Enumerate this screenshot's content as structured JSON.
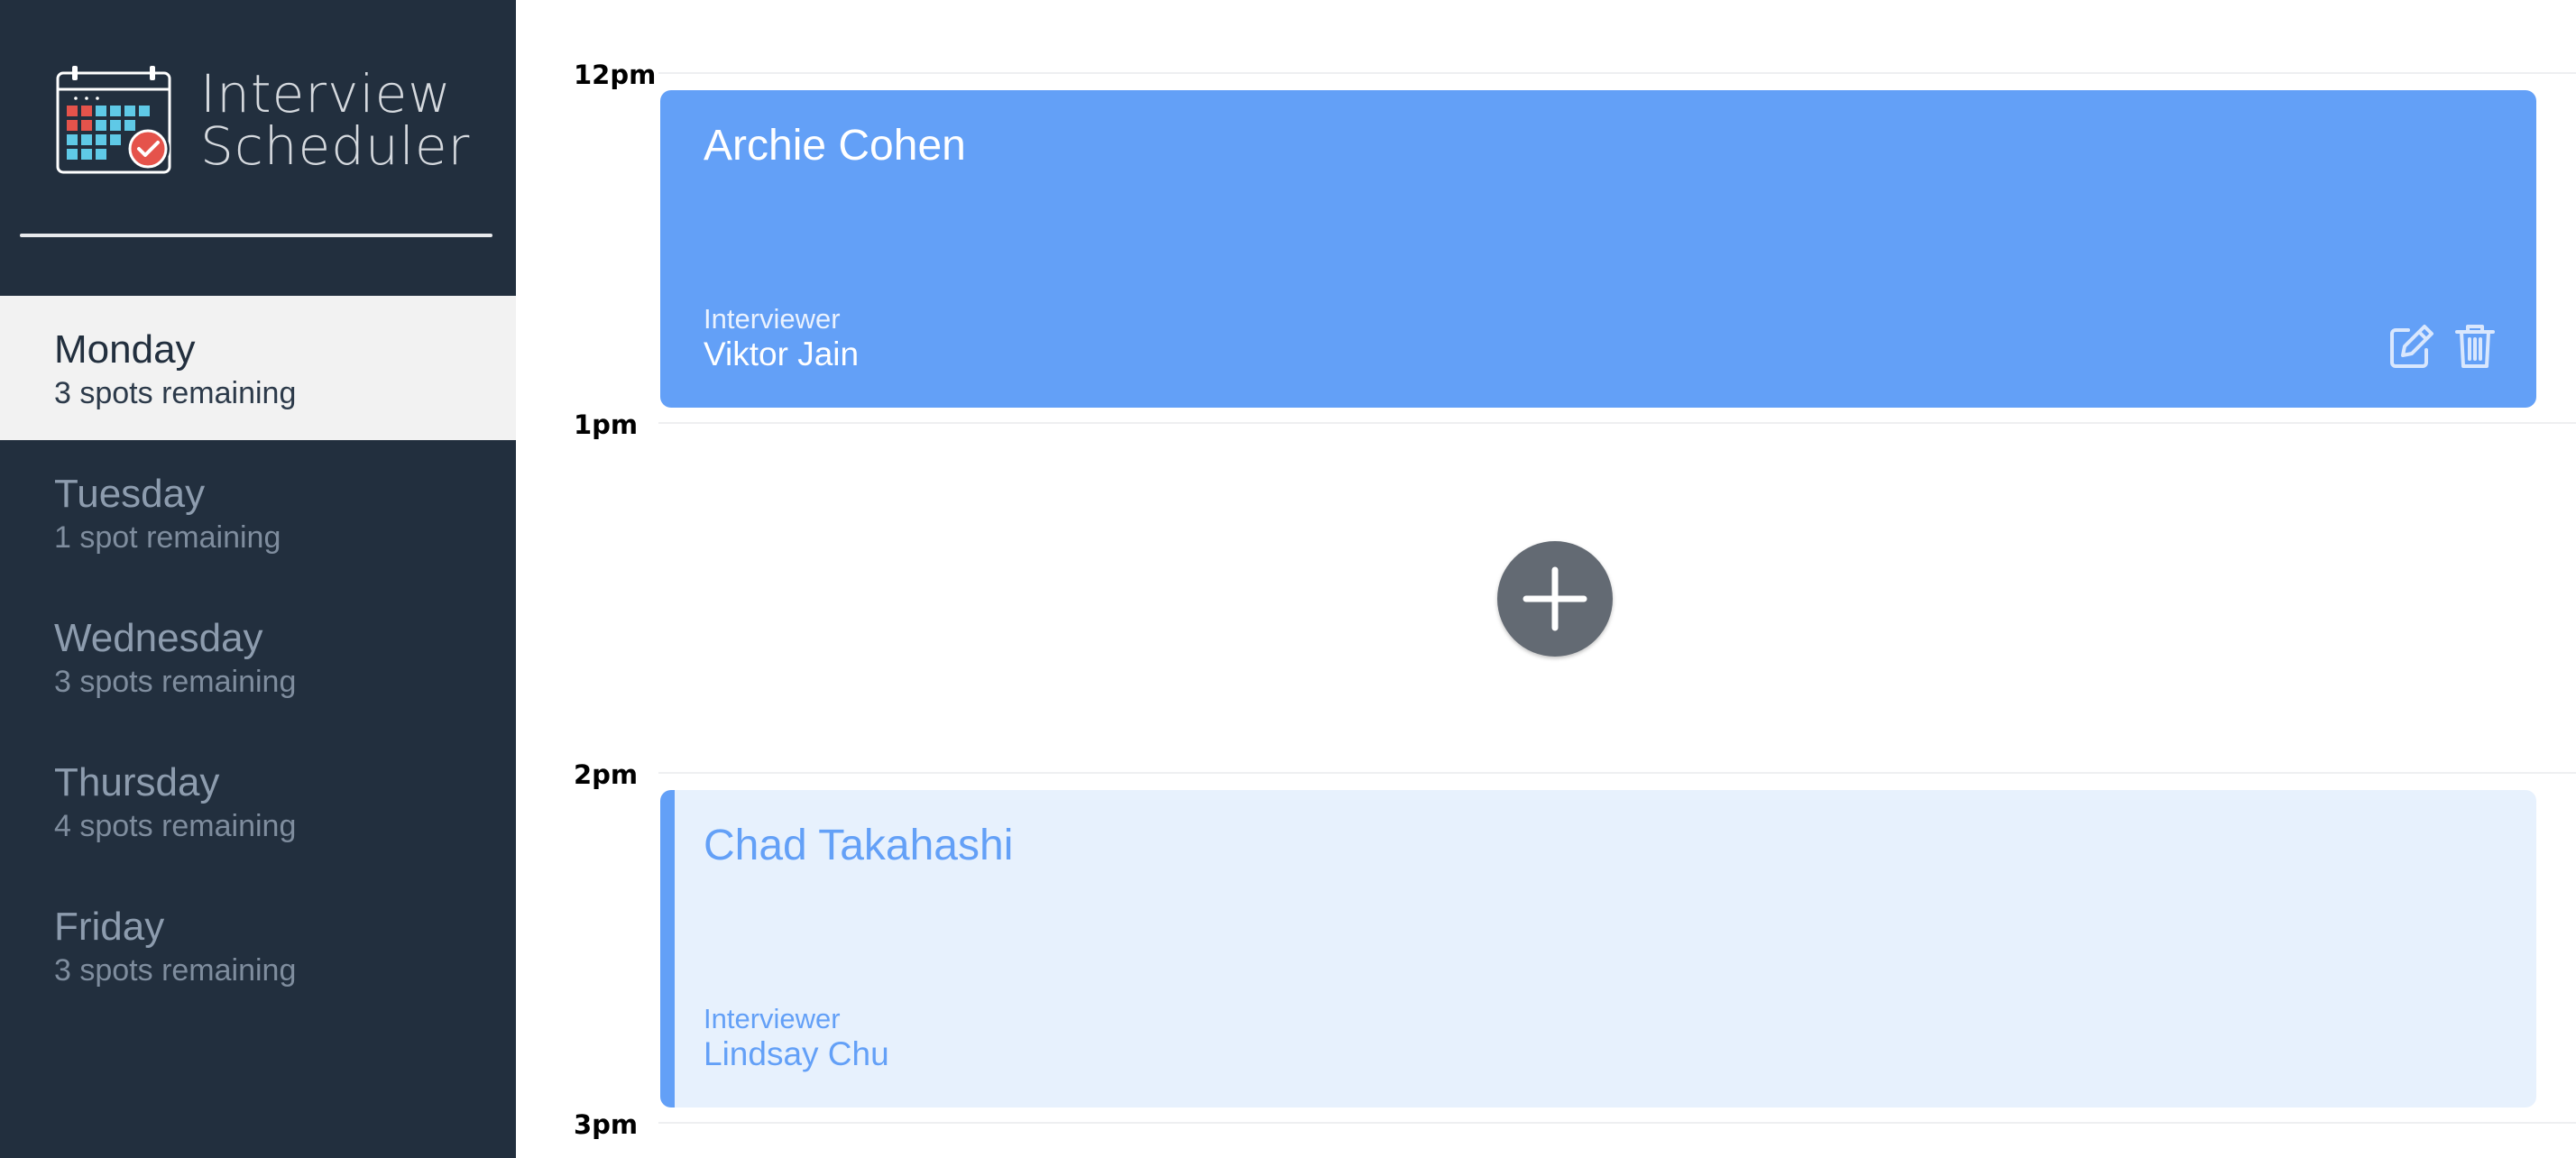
{
  "app": {
    "title_line1": "Interview",
    "title_line2": "Scheduler",
    "logo_icon": "calendar-check-icon"
  },
  "days": [
    {
      "name": "Monday",
      "spots": "3 spots remaining",
      "selected": true
    },
    {
      "name": "Tuesday",
      "spots": "1 spot remaining",
      "selected": false
    },
    {
      "name": "Wednesday",
      "spots": "3 spots remaining",
      "selected": false
    },
    {
      "name": "Thursday",
      "spots": "4 spots remaining",
      "selected": false
    },
    {
      "name": "Friday",
      "spots": "3 spots remaining",
      "selected": false
    }
  ],
  "schedule": {
    "times": [
      "12pm",
      "1pm",
      "2pm",
      "3pm"
    ],
    "appointments": [
      {
        "student": "Archie Cohen",
        "interviewer_label": "Interviewer",
        "interviewer": "Viktor Jain",
        "state": "booked"
      },
      {
        "state": "empty",
        "add_icon": "plus-icon"
      },
      {
        "student": "Chad Takahashi",
        "interviewer_label": "Interviewer",
        "interviewer": "Lindsay Chu",
        "state": "pending"
      }
    ],
    "actions": {
      "edit_icon": "edit-icon",
      "delete_icon": "trash-icon"
    }
  },
  "colors": {
    "sidebar": "#222f3e",
    "accent": "#63a0f7",
    "selected_day": "#f2f2f2",
    "add_button": "#636a73"
  }
}
